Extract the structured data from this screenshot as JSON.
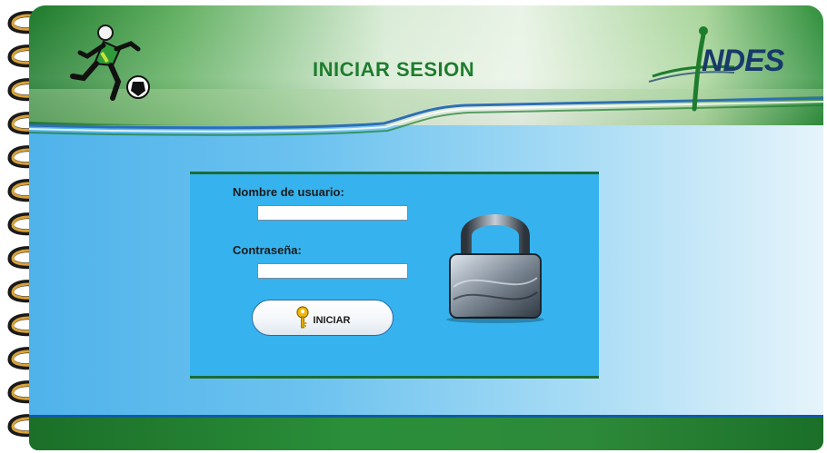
{
  "header": {
    "title": "INICIAR SESION",
    "logo_text": "NDES"
  },
  "login": {
    "username_label": "Nombre de usuario:",
    "username_value": "",
    "password_label": "Contraseña:",
    "password_value": "",
    "submit_label": "INICIAR"
  },
  "colors": {
    "title_green": "#1e7d2d",
    "panel_blue": "#36b3ee",
    "panel_border": "#1a6b35"
  },
  "icons": [
    "runner-icon",
    "logo-icon",
    "key-icon",
    "padlock-icon",
    "spiral-rings"
  ]
}
